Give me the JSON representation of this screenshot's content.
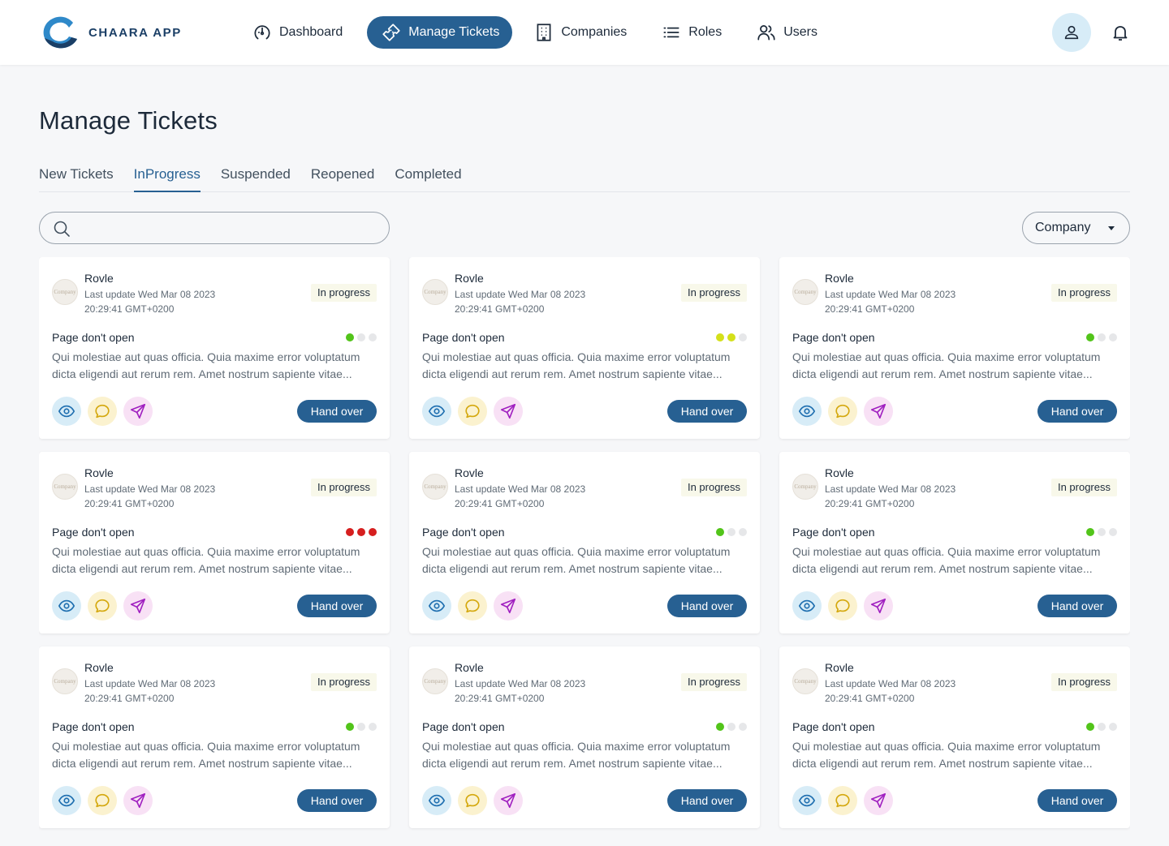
{
  "app": {
    "name": "CHAARA APP",
    "brand_color": "#276092"
  },
  "nav": [
    {
      "label": "Dashboard",
      "icon": "gauge-icon"
    },
    {
      "label": "Manage Tickets",
      "icon": "ticket-icon",
      "active": true
    },
    {
      "label": "Companies",
      "icon": "building-icon"
    },
    {
      "label": "Roles",
      "icon": "list-icon"
    },
    {
      "label": "Users",
      "icon": "users-icon"
    }
  ],
  "page": {
    "title": "Manage Tickets"
  },
  "tabs": [
    {
      "label": "New Tickets"
    },
    {
      "label": "InProgress",
      "active": true
    },
    {
      "label": "Suspended"
    },
    {
      "label": "Reopened"
    },
    {
      "label": "Completed"
    }
  ],
  "search": {
    "value": "",
    "placeholder": ""
  },
  "filter": {
    "label": "Company"
  },
  "cards": [
    {
      "company": "Rovle",
      "thumb_text": "Company",
      "updated_line1": "Last update Wed Mar 08 2023",
      "updated_line2": "20:29:41 GMT+0200",
      "status": "In progress",
      "subject": "Page don't open",
      "description": "Qui molestiae aut quas officia. Quia maxime error voluptatum dicta eligendi aut rerum rem. Amet nostrum sapiente vitae...",
      "priority": {
        "level": 1,
        "color": "#52c41a"
      },
      "action_label": "Hand over"
    },
    {
      "company": "Rovle",
      "thumb_text": "Company",
      "updated_line1": "Last update Wed Mar 08 2023",
      "updated_line2": "20:29:41 GMT+0200",
      "status": "In progress",
      "subject": "Page don't open",
      "description": "Qui molestiae aut quas officia. Quia maxime error voluptatum dicta eligendi aut rerum rem. Amet nostrum sapiente vitae...",
      "priority": {
        "level": 2,
        "color": "#d4e01a"
      },
      "action_label": "Hand over"
    },
    {
      "company": "Rovle",
      "thumb_text": "Company",
      "updated_line1": "Last update Wed Mar 08 2023",
      "updated_line2": "20:29:41 GMT+0200",
      "status": "In progress",
      "subject": "Page don't open",
      "description": "Qui molestiae aut quas officia. Quia maxime error voluptatum dicta eligendi aut rerum rem. Amet nostrum sapiente vitae...",
      "priority": {
        "level": 1,
        "color": "#52c41a"
      },
      "action_label": "Hand over"
    },
    {
      "company": "Rovle",
      "thumb_text": "Company",
      "updated_line1": "Last update Wed Mar 08 2023",
      "updated_line2": "20:29:41 GMT+0200",
      "status": "In progress",
      "subject": "Page don't open",
      "description": "Qui molestiae aut quas officia. Quia maxime error voluptatum dicta eligendi aut rerum rem. Amet nostrum sapiente vitae...",
      "priority": {
        "level": 3,
        "color": "#d61f1f"
      },
      "action_label": "Hand over"
    },
    {
      "company": "Rovle",
      "thumb_text": "Company",
      "updated_line1": "Last update Wed Mar 08 2023",
      "updated_line2": "20:29:41 GMT+0200",
      "status": "In progress",
      "subject": "Page don't open",
      "description": "Qui molestiae aut quas officia. Quia maxime error voluptatum dicta eligendi aut rerum rem. Amet nostrum sapiente vitae...",
      "priority": {
        "level": 1,
        "color": "#52c41a"
      },
      "action_label": "Hand over"
    },
    {
      "company": "Rovle",
      "thumb_text": "Company",
      "updated_line1": "Last update Wed Mar 08 2023",
      "updated_line2": "20:29:41 GMT+0200",
      "status": "In progress",
      "subject": "Page don't open",
      "description": "Qui molestiae aut quas officia. Quia maxime error voluptatum dicta eligendi aut rerum rem. Amet nostrum sapiente vitae...",
      "priority": {
        "level": 1,
        "color": "#52c41a"
      },
      "action_label": "Hand over"
    },
    {
      "company": "Rovle",
      "thumb_text": "Company",
      "updated_line1": "Last update Wed Mar 08 2023",
      "updated_line2": "20:29:41 GMT+0200",
      "status": "In progress",
      "subject": "Page don't open",
      "description": "Qui molestiae aut quas officia. Quia maxime error voluptatum dicta eligendi aut rerum rem. Amet nostrum sapiente vitae...",
      "priority": {
        "level": 1,
        "color": "#52c41a"
      },
      "action_label": "Hand over"
    },
    {
      "company": "Rovle",
      "thumb_text": "Company",
      "updated_line1": "Last update Wed Mar 08 2023",
      "updated_line2": "20:29:41 GMT+0200",
      "status": "In progress",
      "subject": "Page don't open",
      "description": "Qui molestiae aut quas officia. Quia maxime error voluptatum dicta eligendi aut rerum rem. Amet nostrum sapiente vitae...",
      "priority": {
        "level": 1,
        "color": "#52c41a"
      },
      "action_label": "Hand over"
    },
    {
      "company": "Rovle",
      "thumb_text": "Company",
      "updated_line1": "Last update Wed Mar 08 2023",
      "updated_line2": "20:29:41 GMT+0200",
      "status": "In progress",
      "subject": "Page don't open",
      "description": "Qui molestiae aut quas officia. Quia maxime error voluptatum dicta eligendi aut rerum rem. Amet nostrum sapiente vitae...",
      "priority": {
        "level": 1,
        "color": "#52c41a"
      },
      "action_label": "Hand over"
    }
  ],
  "action_icons": {
    "view": "eye-icon",
    "chat": "chat-bubble-icon",
    "send": "send-icon"
  },
  "colors": {
    "view": "#1f6fb0",
    "chat": "#d4a80e",
    "send": "#a020c0"
  }
}
